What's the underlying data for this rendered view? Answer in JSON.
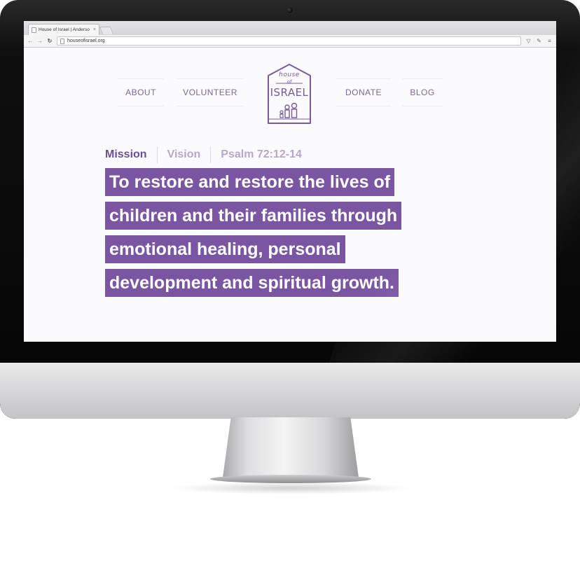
{
  "browser": {
    "tab_title": "House of Israel | Anderso",
    "tab_close": "×",
    "url": "houseofisrael.org",
    "icons": {
      "back": "back-arrow-icon",
      "forward": "forward-arrow-icon",
      "reload": "reload-icon",
      "pocket": "pocket-icon",
      "extension": "extension-icon",
      "menu": "menu-icon"
    }
  },
  "site": {
    "nav": {
      "about": "ABOUT",
      "volunteer": "VOLUNTEER",
      "donate": "DONATE",
      "blog": "BLOG"
    },
    "logo": {
      "house": "house",
      "of": "of",
      "israel": "ISRAEL"
    },
    "tabs": [
      {
        "label": "Mission",
        "active": true
      },
      {
        "label": "Vision",
        "active": false
      },
      {
        "label": "Psalm 72:12-14",
        "active": false
      }
    ],
    "statement_lines": [
      "To restore and restore the lives of",
      "children and their families through",
      "emotional healing, personal",
      "development and spiritual growth."
    ]
  },
  "colors": {
    "brand_purple": "#7a56a2",
    "nav_text": "#7c6796",
    "tab_active": "#6d4e95",
    "tab_inactive": "#b8a6cc"
  }
}
